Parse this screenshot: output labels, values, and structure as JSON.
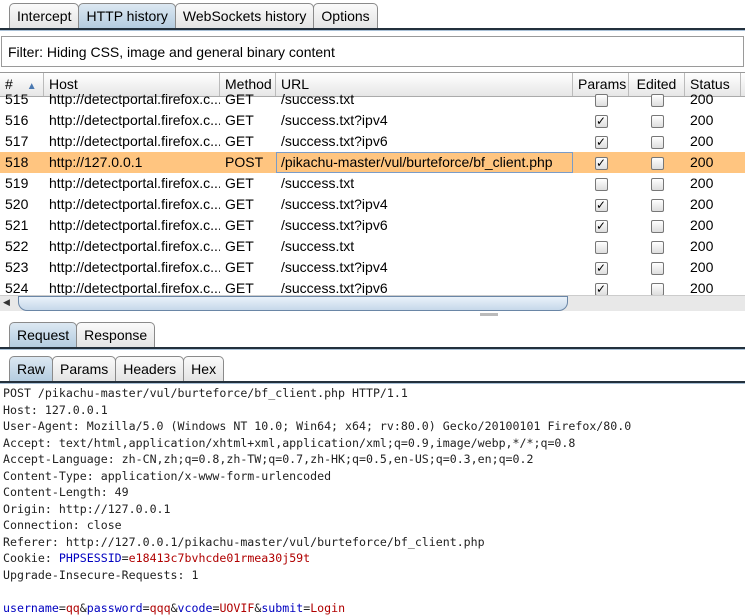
{
  "top_tabs": [
    "Intercept",
    "HTTP history",
    "WebSockets history",
    "Options"
  ],
  "filter": "Filter: Hiding CSS, image and general binary content",
  "columns": [
    "#",
    "Host",
    "Method",
    "URL",
    "Params",
    "Edited",
    "Status"
  ],
  "rows": [
    {
      "id": "515",
      "host": "http://detectportal.firefox.c...",
      "method": "GET",
      "url": "/success.txt",
      "params": false,
      "edited": false,
      "status": "200"
    },
    {
      "id": "516",
      "host": "http://detectportal.firefox.c...",
      "method": "GET",
      "url": "/success.txt?ipv4",
      "params": true,
      "edited": false,
      "status": "200"
    },
    {
      "id": "517",
      "host": "http://detectportal.firefox.c...",
      "method": "GET",
      "url": "/success.txt?ipv6",
      "params": true,
      "edited": false,
      "status": "200"
    },
    {
      "id": "518",
      "host": "http://127.0.0.1",
      "method": "POST",
      "url": "/pikachu-master/vul/burteforce/bf_client.php",
      "params": true,
      "edited": false,
      "status": "200",
      "selected": true
    },
    {
      "id": "519",
      "host": "http://detectportal.firefox.c...",
      "method": "GET",
      "url": "/success.txt",
      "params": false,
      "edited": false,
      "status": "200"
    },
    {
      "id": "520",
      "host": "http://detectportal.firefox.c...",
      "method": "GET",
      "url": "/success.txt?ipv4",
      "params": true,
      "edited": false,
      "status": "200"
    },
    {
      "id": "521",
      "host": "http://detectportal.firefox.c...",
      "method": "GET",
      "url": "/success.txt?ipv6",
      "params": true,
      "edited": false,
      "status": "200"
    },
    {
      "id": "522",
      "host": "http://detectportal.firefox.c...",
      "method": "GET",
      "url": "/success.txt",
      "params": false,
      "edited": false,
      "status": "200"
    },
    {
      "id": "523",
      "host": "http://detectportal.firefox.c...",
      "method": "GET",
      "url": "/success.txt?ipv4",
      "params": true,
      "edited": false,
      "status": "200"
    },
    {
      "id": "524",
      "host": "http://detectportal.firefox.c...",
      "method": "GET",
      "url": "/success.txt?ipv6",
      "params": true,
      "edited": false,
      "status": "200"
    }
  ],
  "sort_icon": "triangle-up",
  "req_tabs": [
    "Request",
    "Response"
  ],
  "view_tabs": [
    "Raw",
    "Params",
    "Headers",
    "Hex"
  ],
  "request_lines": [
    "POST /pikachu-master/vul/burteforce/bf_client.php HTTP/1.1",
    "Host: 127.0.0.1",
    "User-Agent: Mozilla/5.0 (Windows NT 10.0; Win64; x64; rv:80.0) Gecko/20100101 Firefox/80.0",
    "Accept: text/html,application/xhtml+xml,application/xml;q=0.9,image/webp,*/*;q=0.8",
    "Accept-Language: zh-CN,zh;q=0.8,zh-TW;q=0.7,zh-HK;q=0.5,en-US;q=0.3,en;q=0.2",
    "Content-Type: application/x-www-form-urlencoded",
    "Content-Length: 49",
    "Origin: http://127.0.0.1",
    "Connection: close",
    "Referer: http://127.0.0.1/pikachu-master/vul/burteforce/bf_client.php"
  ],
  "cookie": {
    "label": "Cookie: ",
    "name": "PHPSESSID",
    "value": "e18413c7bvhcde01rmea30j59t"
  },
  "upgrade_line": "Upgrade-Insecure-Requests: 1",
  "body_params": [
    {
      "name": "username",
      "value": "qq"
    },
    {
      "name": "password",
      "value": "qqq"
    },
    {
      "name": "vcode",
      "value": "UOVIF"
    },
    {
      "name": "submit",
      "value": "Login"
    }
  ],
  "colors": {
    "selected_row": "#ffc580",
    "param_name": "#0000c0",
    "param_value": "#b00000"
  }
}
